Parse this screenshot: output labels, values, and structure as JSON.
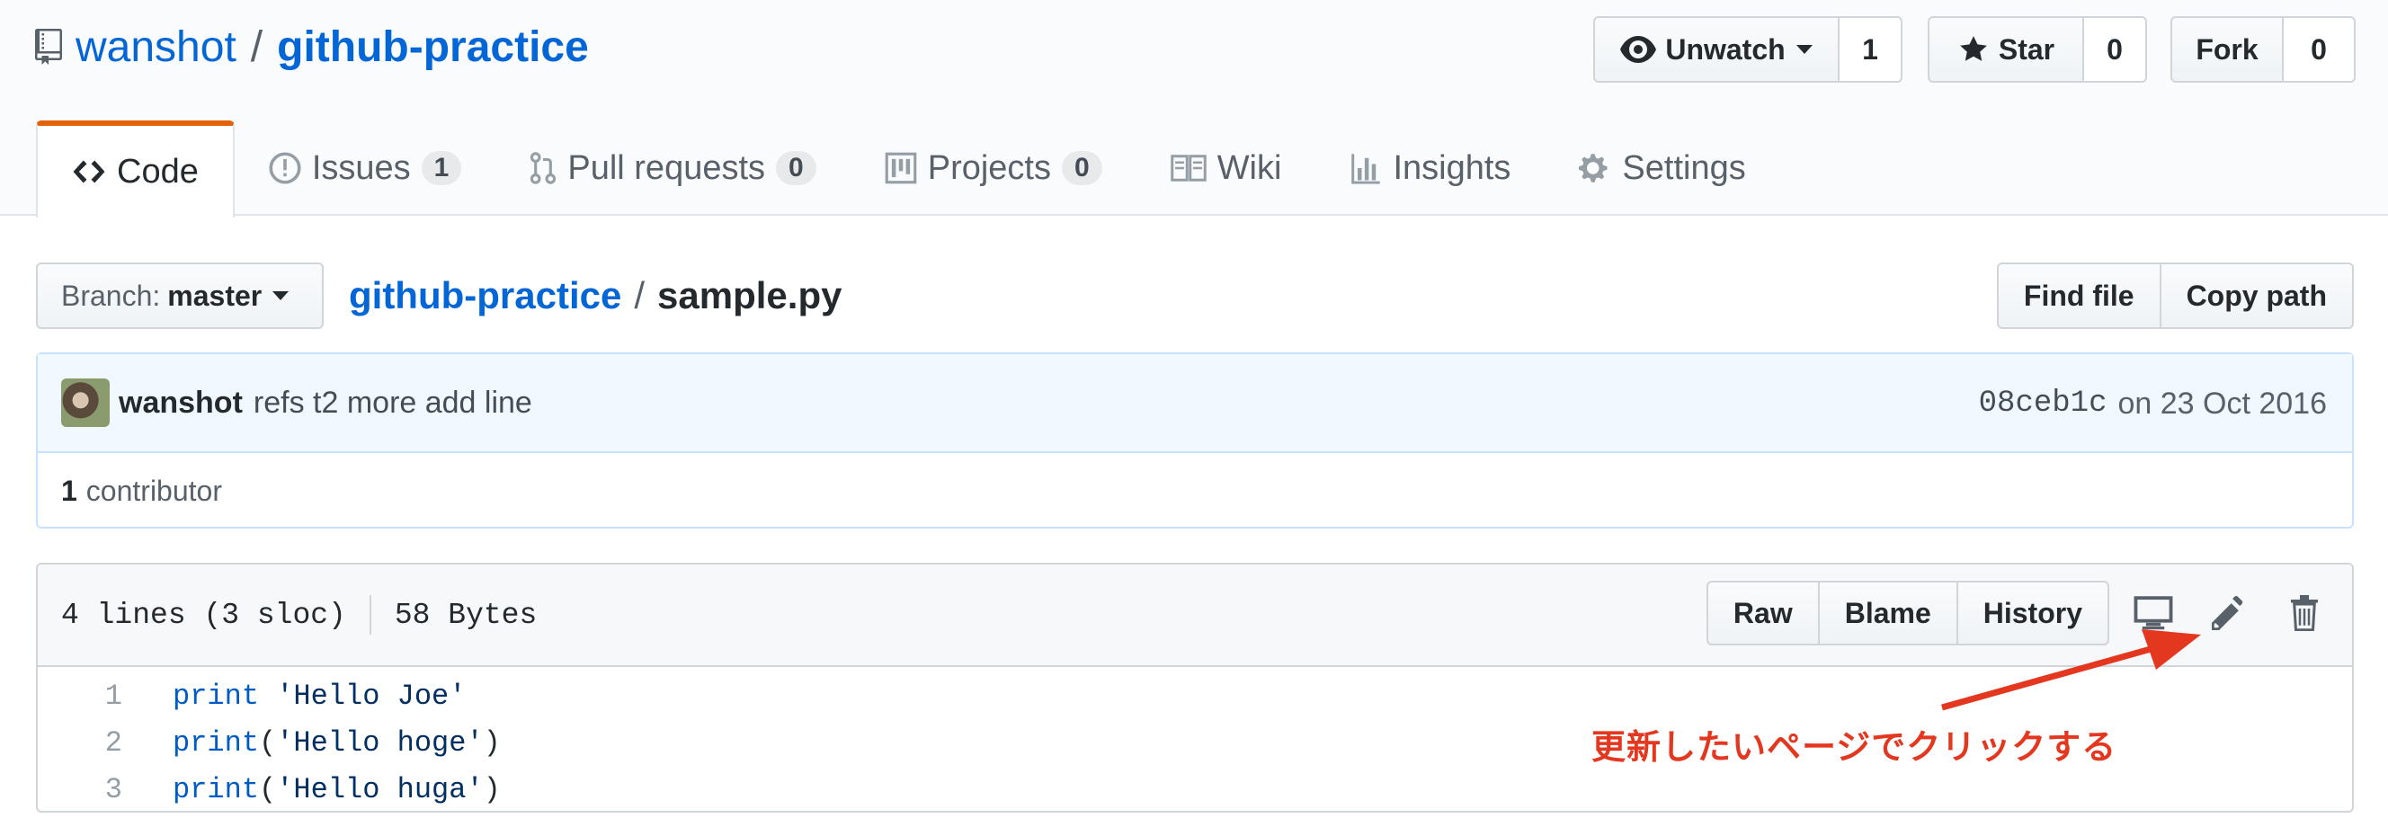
{
  "repo": {
    "owner": "wanshot",
    "separator": "/",
    "name": "github-practice"
  },
  "actions": {
    "watch": {
      "label": "Unwatch",
      "count": "1"
    },
    "star": {
      "label": "Star",
      "count": "0"
    },
    "fork": {
      "label": "Fork",
      "count": "0"
    }
  },
  "tabs": [
    {
      "label": "Code",
      "icon": "code-icon"
    },
    {
      "label": "Issues",
      "count": "1",
      "icon": "issue-icon"
    },
    {
      "label": "Pull requests",
      "count": "0",
      "icon": "pull-request-icon"
    },
    {
      "label": "Projects",
      "count": "0",
      "icon": "project-icon"
    },
    {
      "label": "Wiki",
      "icon": "book-icon"
    },
    {
      "label": "Insights",
      "icon": "graph-icon"
    },
    {
      "label": "Settings",
      "icon": "gear-icon"
    }
  ],
  "branch": {
    "prefix": "Branch:",
    "name": "master"
  },
  "breadcrumb": {
    "root": "github-practice",
    "separator": "/",
    "file": "sample.py"
  },
  "file_buttons": {
    "find": "Find file",
    "copy": "Copy path"
  },
  "commit": {
    "author": "wanshot",
    "message": "refs t2 more add line",
    "sha": "08ceb1c",
    "date": "on 23 Oct 2016"
  },
  "contributors": {
    "count": "1",
    "label": "contributor"
  },
  "file": {
    "lines_info": "4 lines (3 sloc)",
    "size": "58 Bytes",
    "buttons": {
      "raw": "Raw",
      "blame": "Blame",
      "history": "History"
    },
    "code": [
      {
        "num": "1",
        "kw": "print",
        "rest_pre": " ",
        "str": "'Hello Joe'",
        "rest_post": ""
      },
      {
        "num": "2",
        "kw": "print",
        "rest_pre": "(",
        "str": "'Hello hoge'",
        "rest_post": ")"
      },
      {
        "num": "3",
        "kw": "print",
        "rest_pre": "(",
        "str": "'Hello huga'",
        "rest_post": ")"
      }
    ]
  },
  "annotation": {
    "text": "更新したいページでクリックする",
    "color": "#e4371f"
  },
  "colors": {
    "link": "#0366d6",
    "tab_accent": "#e36209",
    "annotation": "#e4371f"
  }
}
